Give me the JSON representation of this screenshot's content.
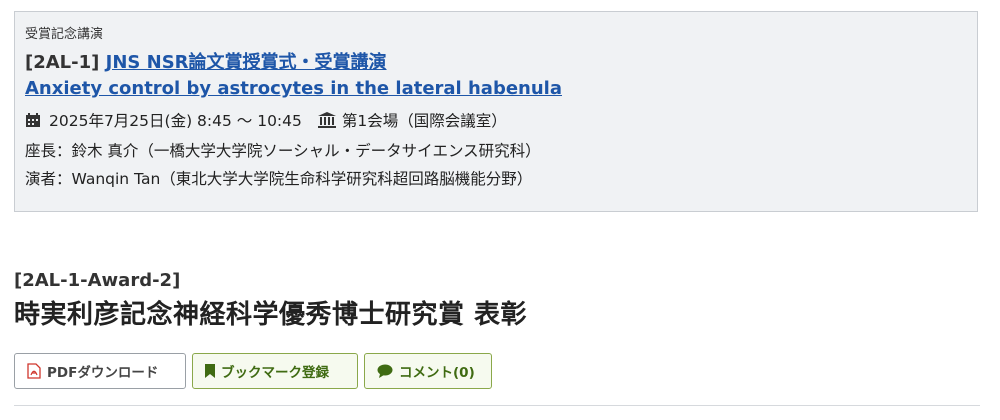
{
  "session": {
    "category": "受賞記念講演",
    "code": "[2AL-1]",
    "title_link": "JNS NSR論文賞授賞式・受賞講演",
    "subtitle_link": "Anxiety control by astrocytes in the lateral habenula",
    "datetime": "2025年7月25日(金) 8:45 〜 10:45",
    "venue": "第1会場（国際会議室）",
    "chair": "座長：鈴木 真介（一橋大学大学院ソーシャル・データサイエンス研究科）",
    "presenter": "演者：Wanqin Tan（東北大学大学院生命科学研究科超回路脳機能分野）",
    "icons": {
      "calendar": "calendar-icon",
      "venue": "building-icon"
    }
  },
  "award": {
    "code": "[2AL-1-Award-2]",
    "title": "時実利彦記念神経科学優秀博士研究賞 表彰"
  },
  "buttons": {
    "pdf": "PDFダウンロード",
    "bookmark": "ブックマーク登録",
    "comment": "コメント(0)"
  },
  "colors": {
    "link": "#1e56a8",
    "accent_green": "#3f6b12",
    "pdf_red": "#d0362c"
  }
}
